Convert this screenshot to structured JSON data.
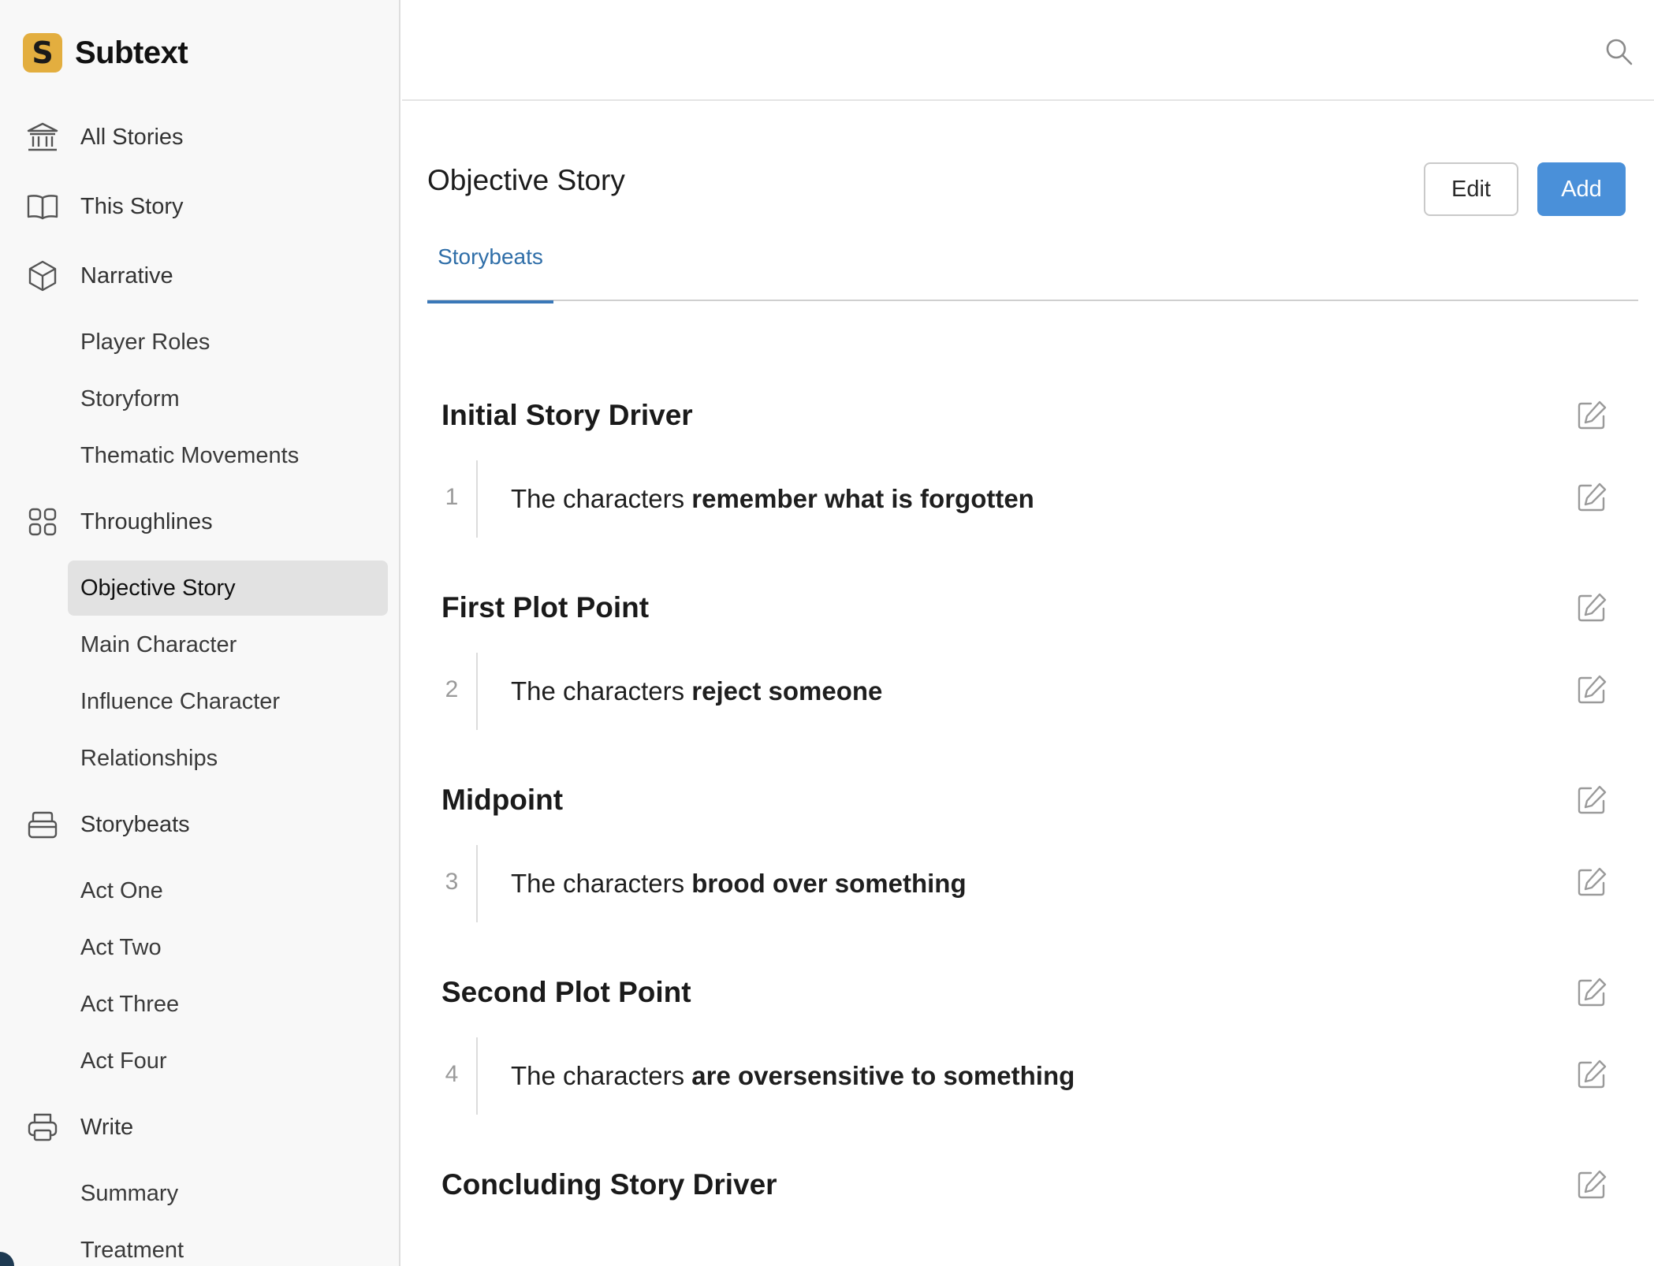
{
  "app": {
    "name": "Subtext",
    "logo_letter": "S",
    "logo_color": "#e3ae3f"
  },
  "sidebar": {
    "nav": [
      {
        "label": "All Stories",
        "icon": "bank-icon"
      },
      {
        "label": "This Story",
        "icon": "book-icon"
      },
      {
        "label": "Narrative",
        "icon": "cube-icon"
      },
      {
        "label": "Player Roles"
      },
      {
        "label": "Storyform"
      },
      {
        "label": "Thematic Movements"
      },
      {
        "label": "Throughlines",
        "icon": "grid-icon"
      },
      {
        "label": "Objective Story",
        "active": true
      },
      {
        "label": "Main Character"
      },
      {
        "label": "Influence Character"
      },
      {
        "label": "Relationships"
      },
      {
        "label": "Storybeats",
        "icon": "tray-icon"
      },
      {
        "label": "Act One"
      },
      {
        "label": "Act Two"
      },
      {
        "label": "Act Three"
      },
      {
        "label": "Act Four"
      },
      {
        "label": "Write",
        "icon": "printer-icon"
      },
      {
        "label": "Summary"
      },
      {
        "label": "Treatment"
      }
    ]
  },
  "header": {
    "search_icon": "search-icon"
  },
  "main": {
    "title": "Objective Story",
    "edit_label": "Edit",
    "add_label": "Add",
    "add_color": "#4a90d9",
    "tabs": [
      {
        "label": "Storybeats",
        "active": true
      }
    ],
    "sections": [
      {
        "title": "Initial Story Driver",
        "beat": {
          "number": "1",
          "prefix": "The characters ",
          "emphasis": "remember what is forgotten"
        }
      },
      {
        "title": "First Plot Point",
        "beat": {
          "number": "2",
          "prefix": "The characters ",
          "emphasis": "reject someone"
        }
      },
      {
        "title": "Midpoint",
        "beat": {
          "number": "3",
          "prefix": "The characters ",
          "emphasis": "brood over something"
        }
      },
      {
        "title": "Second Plot Point",
        "beat": {
          "number": "4",
          "prefix": "The characters ",
          "emphasis": "are oversensitive to something"
        }
      },
      {
        "title": "Concluding Story Driver"
      }
    ]
  }
}
